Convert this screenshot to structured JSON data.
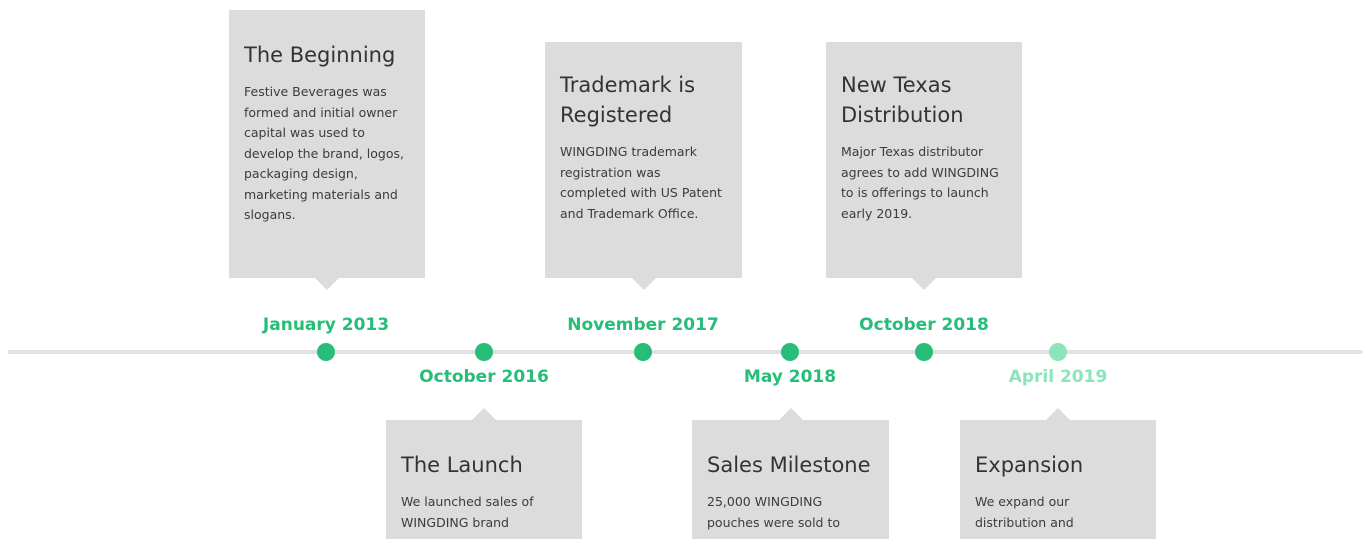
{
  "colors": {
    "accent": "#25bd78",
    "accent_future": "#8ae5bb",
    "card_bg": "#dcdcdc",
    "line": "#e2e2e2"
  },
  "milestones": [
    {
      "date": "January 2013",
      "title": "The Beginning",
      "body": "Festive Beverages was formed and initial owner capital was used to develop the brand, logos, packaging design, marketing materials and slogans."
    },
    {
      "date": "October 2016",
      "title": "The Launch",
      "body": "We launched sales of WINGDING brand"
    },
    {
      "date": "November 2017",
      "title": "Trademark is Registered",
      "body": "WINGDING trademark registration was completed with US Patent and Trademark Office."
    },
    {
      "date": "May 2018",
      "title": "Sales Milestone",
      "body": "25,000 WINGDING pouches were sold to"
    },
    {
      "date": "October 2018",
      "title": "New Texas Distribution",
      "body": "Major Texas distributor agrees to add WINGDING to is offerings to launch early 2019."
    },
    {
      "date": "April 2019",
      "title": "Expansion",
      "body": "We expand our distribution and"
    }
  ]
}
